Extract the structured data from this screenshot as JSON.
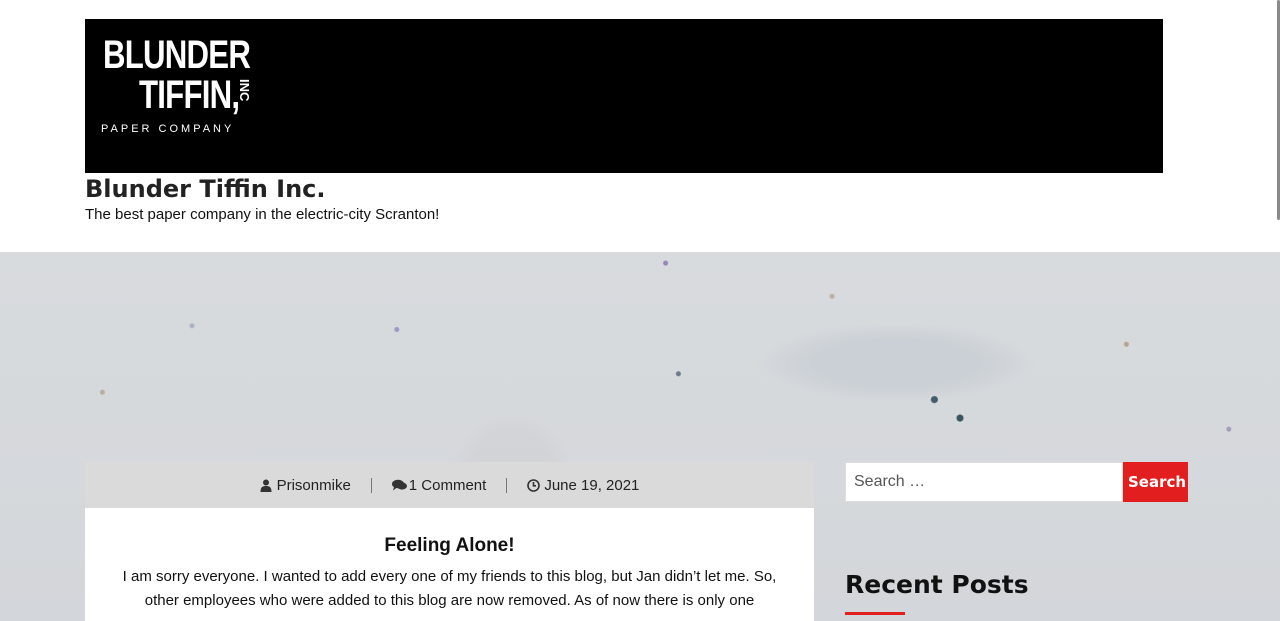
{
  "header": {
    "logo": {
      "line1": "BLUNDER",
      "line2": "TIFFIN,",
      "inc": "INC",
      "tagline": "PAPER COMPANY"
    },
    "site_title": "Blunder Tiffin Inc.",
    "site_description": "The best paper company in the electric-city Scranton!"
  },
  "post": {
    "meta": {
      "author": "Prisonmike",
      "comments": "1 Comment",
      "date": "June 19, 2021"
    },
    "title": "Feeling Alone!",
    "excerpt": "I am sorry everyone. I wanted to add every one of my friends to this blog, but Jan didn’t let me. So, other employees who were added to this blog are now removed. As of now there is only one"
  },
  "sidebar": {
    "search": {
      "placeholder": "Search …",
      "button_label": "Search"
    },
    "widget_title": "Recent Posts"
  },
  "colors": {
    "accent": "#e31e1e",
    "banner": "#000000",
    "meta_bar": "#dadada"
  },
  "icons": [
    "user-icon",
    "comments-icon",
    "clock-icon"
  ]
}
